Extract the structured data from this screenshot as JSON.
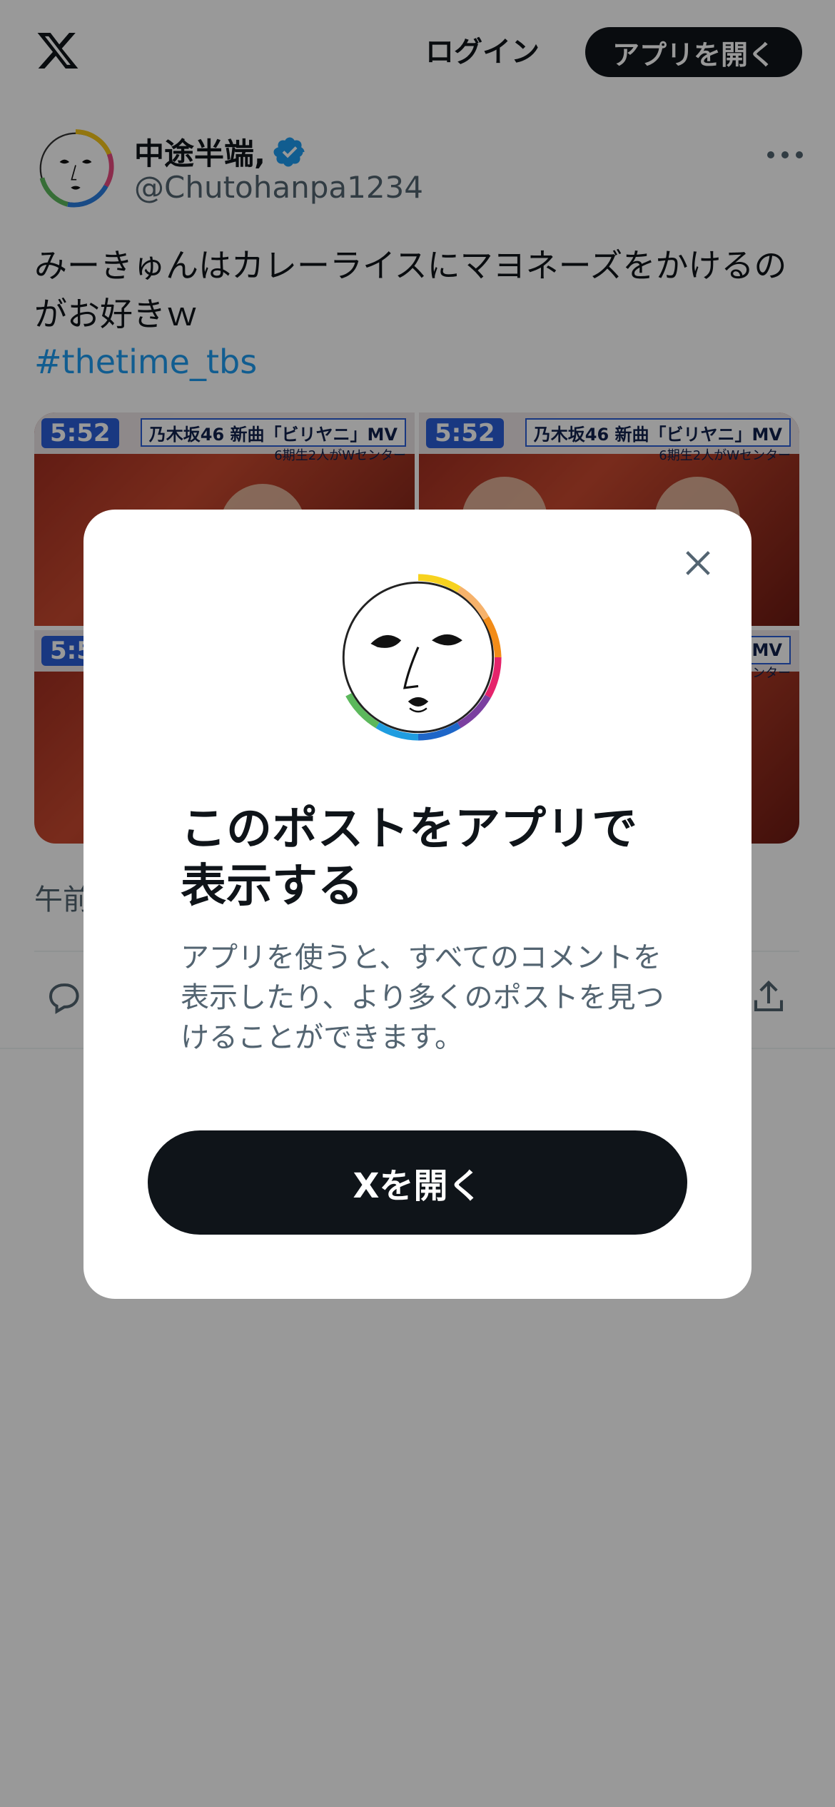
{
  "header": {
    "logo_icon": "x-logo-icon",
    "login_label": "ログイン",
    "open_app_label": "アプリを開く"
  },
  "post": {
    "author_name": "中途半端,",
    "verified_icon": "verified-badge-icon",
    "handle": "@Chutohanpa1234",
    "text": "みーきゅんはカレーライスにマヨネーズをかけるのがお好きｗ",
    "hashtag": "#thetime_tbs",
    "media": [
      {
        "clock": "5:52",
        "caption": "乃木坂46 新曲「ビリヤニ」MV",
        "sub": "6期生2人がWセンター"
      },
      {
        "clock": "5:52",
        "caption": "乃木坂46 新曲「ビリヤニ」MV",
        "sub": "6期生2人がWセンター"
      },
      {
        "clock": "5:5",
        "caption": "",
        "sub": ""
      },
      {
        "clock": "",
        "caption": "MV",
        "sub": "センター"
      }
    ],
    "timestamp": "午前",
    "actions": [
      "reply-icon",
      "share-icon"
    ]
  },
  "modal": {
    "close_icon": "close-icon",
    "title": "このポストをアプリで表示する",
    "body": "アプリを使うと、すべてのコメントを表示したり、より多くのポストを見つけることができます。",
    "button_label": "Xを開く"
  },
  "colors": {
    "text": "#0f1419",
    "secondary": "#536471",
    "accent": "#1d9bf0",
    "overlay": "rgba(0,0,0,0.4)"
  }
}
